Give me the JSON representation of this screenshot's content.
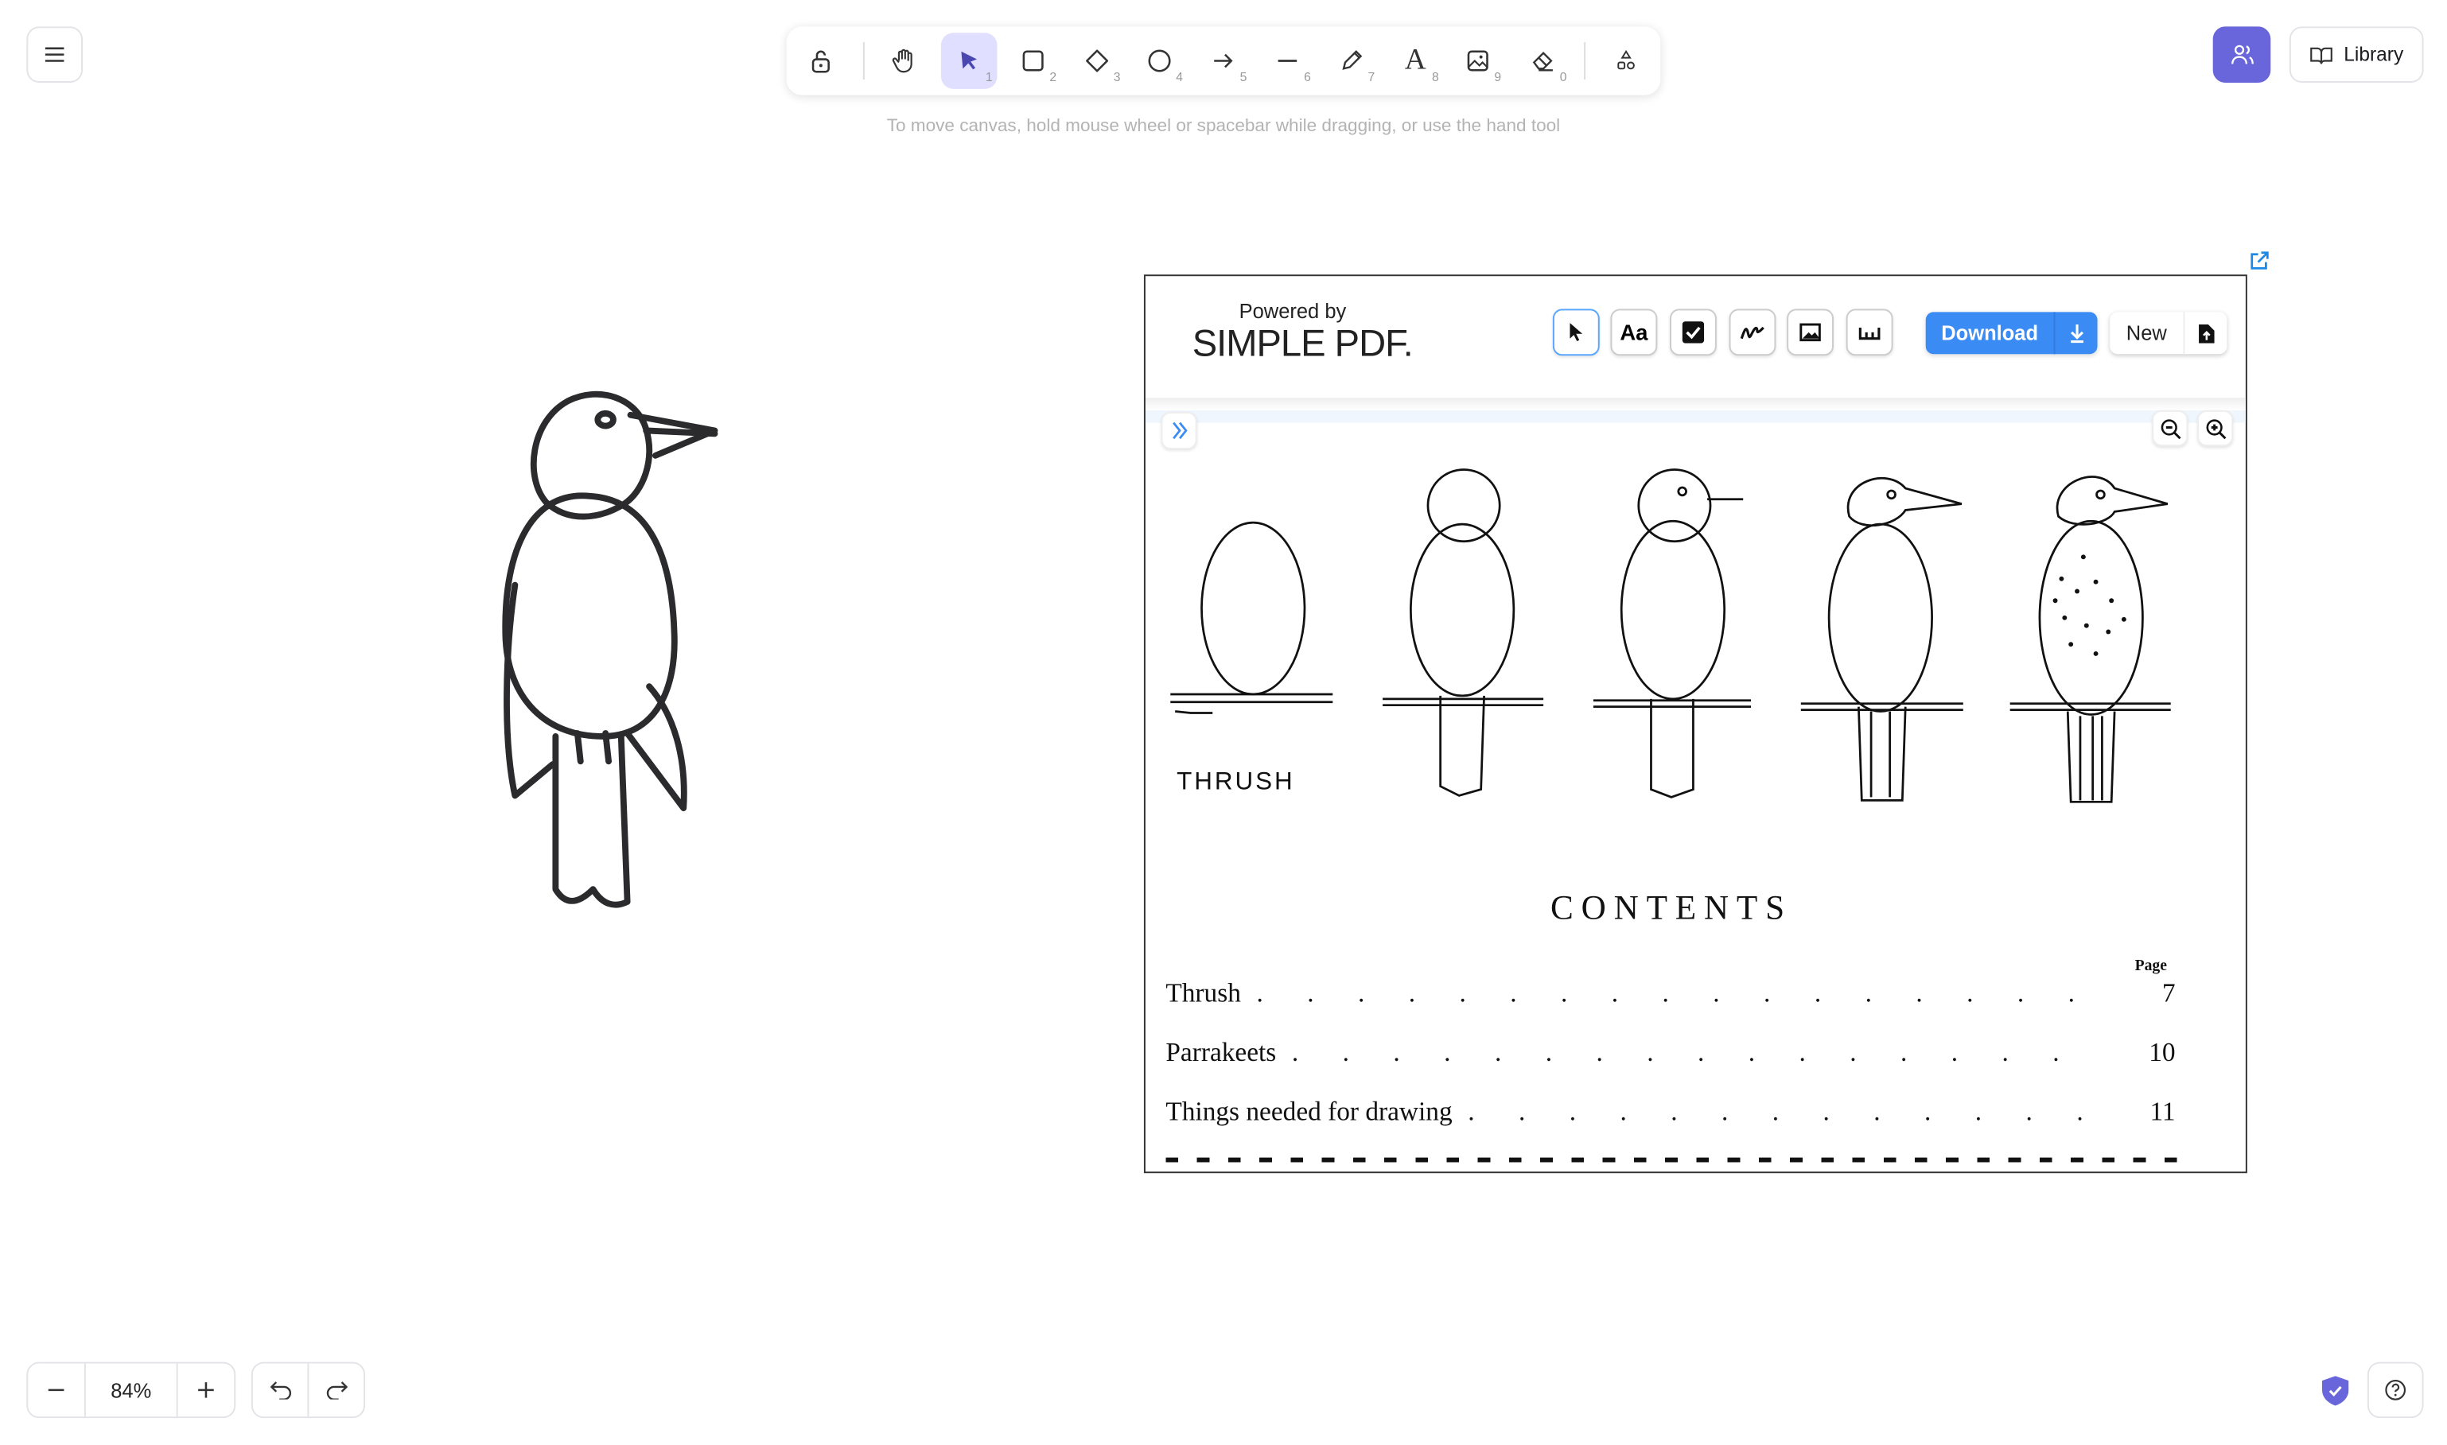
{
  "toolbar": {
    "tools": [
      {
        "name": "lock",
        "icon": "lock-open-icon"
      },
      {
        "name": "hand",
        "icon": "hand-icon"
      },
      {
        "name": "selection",
        "icon": "pointer-icon",
        "key": "1",
        "active": true
      },
      {
        "name": "rectangle",
        "icon": "square-icon",
        "key": "2"
      },
      {
        "name": "diamond",
        "icon": "diamond-icon",
        "key": "3"
      },
      {
        "name": "ellipse",
        "icon": "circle-icon",
        "key": "4"
      },
      {
        "name": "arrow",
        "icon": "arrow-icon",
        "key": "5"
      },
      {
        "name": "line",
        "icon": "line-icon",
        "key": "6"
      },
      {
        "name": "draw",
        "icon": "pencil-icon",
        "key": "7"
      },
      {
        "name": "text",
        "icon": "text-icon",
        "key": "8"
      },
      {
        "name": "image",
        "icon": "image-icon",
        "key": "9"
      },
      {
        "name": "eraser",
        "icon": "eraser-icon",
        "key": "0"
      },
      {
        "name": "more-shapes",
        "icon": "shapes-icon"
      }
    ],
    "hint": "To move canvas, hold mouse wheel or spacebar while dragging, or use the hand tool"
  },
  "header": {
    "library_label": "Library"
  },
  "footer": {
    "zoom": "84%"
  },
  "accent_color": "#6965db",
  "pdf": {
    "powered_by": "Powered by",
    "brand": "SIMPLE PDF.",
    "download_label": "Download",
    "new_label": "New",
    "primary_color": "#3b8bf5",
    "page": {
      "figure_label": "THRUSH",
      "contents_title": "CONTENTS",
      "page_header": "Page",
      "entries": [
        {
          "title": "Thrush",
          "page": "7"
        },
        {
          "title": "Parrakeets",
          "page": "10"
        },
        {
          "title": "Things needed for drawing",
          "page": "11"
        }
      ]
    }
  }
}
